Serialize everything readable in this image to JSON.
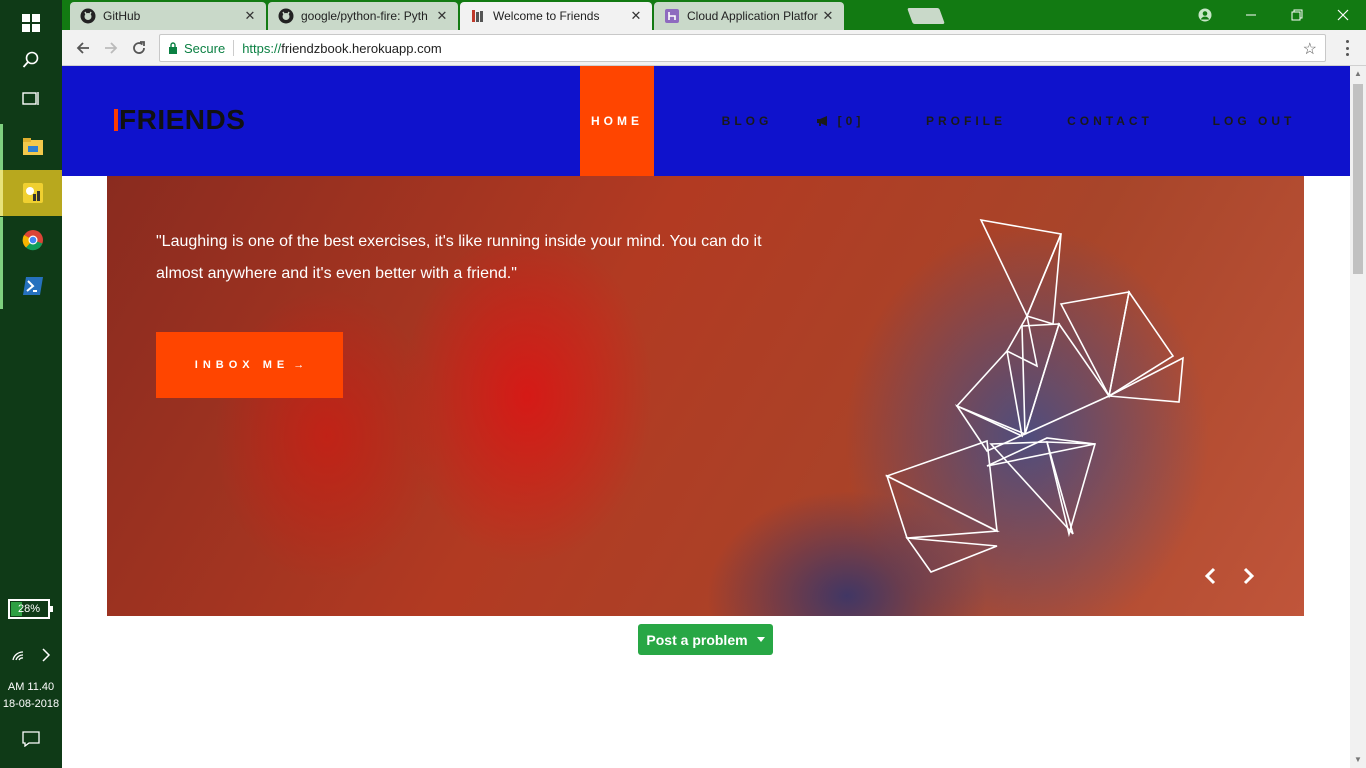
{
  "taskbar": {
    "battery_label": "28%",
    "battery_level": 0.28,
    "clock_time": "AM 11.40",
    "clock_date": "18-08-2018"
  },
  "browser": {
    "tabs": [
      {
        "title": "GitHub",
        "icon": "github-icon"
      },
      {
        "title": "google/python-fire: Pyth",
        "icon": "github-icon"
      },
      {
        "title": "Welcome to Friends",
        "icon": "friends-favicon",
        "active": true
      },
      {
        "title": "Cloud Application Platfor",
        "icon": "heroku-icon"
      }
    ],
    "security_label": "Secure",
    "url_scheme": "https://",
    "url_host": "friendzbook.herokuapp.com"
  },
  "site": {
    "logo": "FRIENDS",
    "nav": {
      "home": "HOME",
      "blog": "BLOG",
      "notifications": "[0]",
      "profile": "PROFILE",
      "contact": "CONTACT",
      "logout": "LOG OUT"
    },
    "hero": {
      "quote": "\"Laughing is one of the best exercises, it's like running inside your mind. You can do it almost anywhere and it's even better with a friend.\"",
      "cta_label": "INBOX ME",
      "cta_arrow": "→"
    },
    "post_problem_label": "Post a problem"
  },
  "colors": {
    "nav_bg": "#0f12cc",
    "accent": "#ff4500",
    "success": "#28a745",
    "tabstrip": "#127a12"
  }
}
